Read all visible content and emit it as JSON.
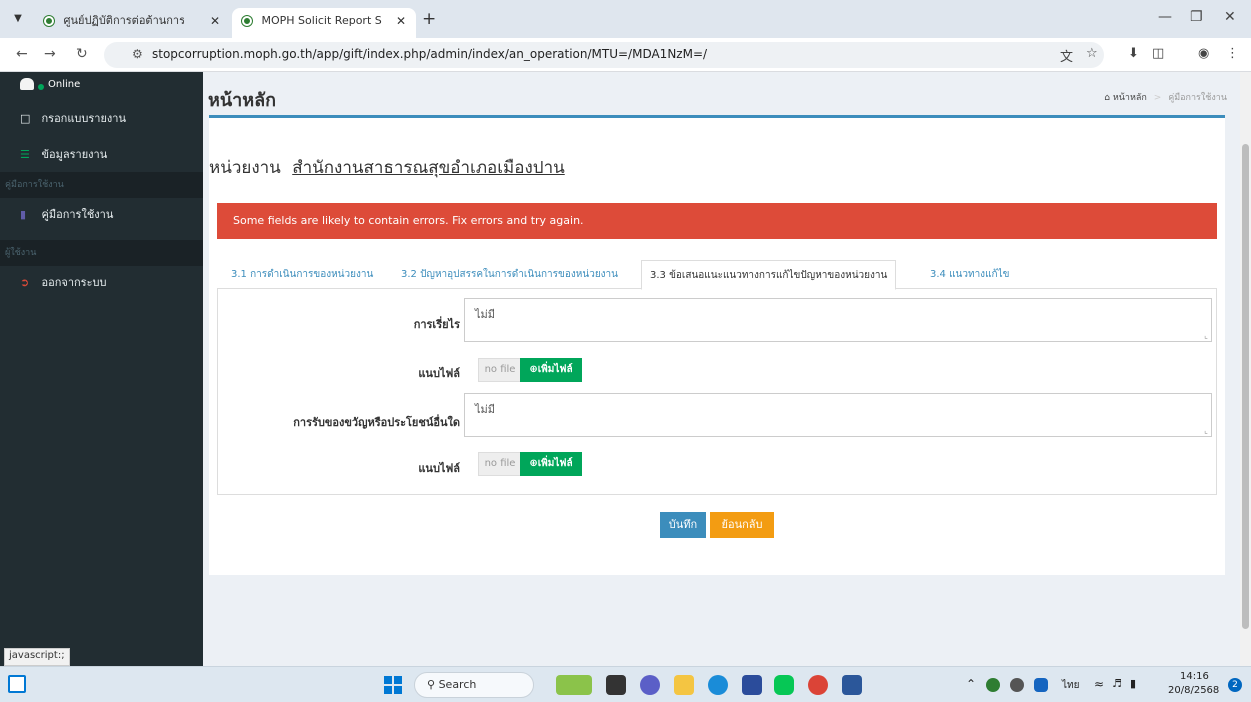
{
  "browser": {
    "tabs": [
      {
        "title": "ศูนย์ปฏิบัติการต่อต้านการทุจริต กระ",
        "active": false
      },
      {
        "title": "MOPH Solicit Report System : M",
        "active": true
      }
    ],
    "new_tab": "+",
    "url": "stopcorruption.moph.go.th/app/gift/index.php/admin/index/an_operation/MTU=/MDA1NzM=/",
    "status_url": "javascript:;"
  },
  "sidebar": {
    "status": "Online",
    "items": [
      {
        "label": "กรอกแบบรายงาน",
        "icon": "file-icon"
      },
      {
        "label": "ข้อมูลรายงาน",
        "icon": "list-icon"
      }
    ],
    "header_manual": "คู่มือการใช้งาน",
    "manual_item": {
      "label": "คู่มือการใช้งาน",
      "icon": "book-icon"
    },
    "header_user": "ผู้ใช้งาน",
    "logout_item": {
      "label": "ออกจากระบบ",
      "icon": "logout-icon"
    }
  },
  "page": {
    "title": "หน้าหลัก",
    "breadcrumb": [
      "หน้าหลัก",
      "คู่มือการใช้งาน"
    ],
    "unit_prefix": "หน่วยงาน",
    "unit_name": "สำนักงานสาธารณสุขอำเภอเมืองปาน",
    "alert": "Some fields are likely to contain errors. Fix errors and try again.",
    "tabs": [
      {
        "label": "3.1 การดำเนินการของหน่วยงาน",
        "active": false
      },
      {
        "label": "3.2 ปัญหาอุปสรรคในการดำเนินการของหน่วยงาน",
        "active": false
      },
      {
        "label": "3.3 ข้อเสนอแนะแนวทางการแก้ไขปัญหาของหน่วยงาน",
        "active": true
      },
      {
        "label": "3.4 แนวทางแก้ไข",
        "active": false
      }
    ],
    "fields": [
      {
        "label": "การเรี่ยไร",
        "value": "ไม่มี"
      },
      {
        "label": "การรับของขวัญหรือประโยชน์อื่นใด",
        "value": "ไม่มี"
      }
    ],
    "attach_label": "แนบไฟล์",
    "no_file": "no file",
    "add_file": "เพิ่มไฟล์",
    "save": "บันทึก",
    "back": "ย้อนกลับ"
  },
  "taskbar": {
    "search": "Search",
    "lang": "ไทย",
    "time": "14:16",
    "date": "20/8/2568",
    "notifications": "2"
  },
  "colors": {
    "sidebar_bg": "#222d32",
    "accent": "#3c8dbc",
    "alert": "#dd4b39",
    "success": "#00a65a",
    "warning": "#f39c12"
  }
}
